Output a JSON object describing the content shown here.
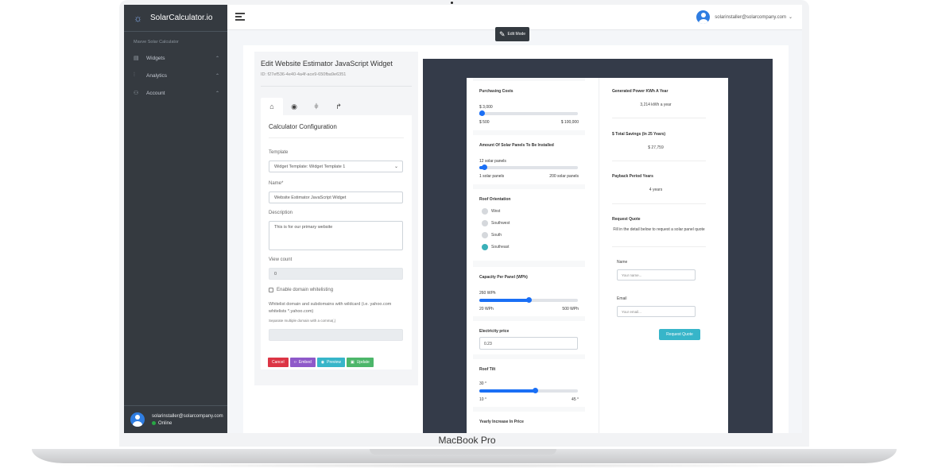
{
  "device": {
    "label": "MacBook Pro"
  },
  "sidebar": {
    "brand": "SolarCalculator.io",
    "section_title": "Mavve Solar Calculator",
    "items": [
      {
        "label": "Widgets",
        "icon": "table-icon"
      },
      {
        "label": "Analytics",
        "icon": "bar-chart-icon"
      },
      {
        "label": "Account",
        "icon": "users-icon"
      }
    ],
    "user_email": "solarinstaller@solarcompany.com",
    "status": "Online"
  },
  "topbar": {
    "user_email": "solarinstaller@solarcompany.com",
    "edit_mode_label": "Edit Mode"
  },
  "editor": {
    "title": "Edit Website Estimator JavaScript Widget",
    "id": "ID: f27ef536-4e40-4a4f-ace9-650fba9e6351",
    "config_title": "Calculator Configuration",
    "template_label": "Template",
    "template_value": "Widget Template: Widget Template 1",
    "name_label": "Name*",
    "name_value": "Website Estimator JavaScript Widget",
    "description_label": "Description",
    "description_value": "This is for our primary website",
    "view_count_label": "View count",
    "view_count_value": "0",
    "whitelist_checkbox": "Enable domain whitelisting",
    "whitelist_note": "Whitelist domain and subdomains with wildcard (i.e. yahoo.com whitelists *.yahoo.com)",
    "whitelist_small": "Separate multiple domain with a comma(,)",
    "buttons": {
      "cancel": "Cancel",
      "embed": "Embed",
      "preview": "Preview",
      "update": "Update"
    }
  },
  "widget": {
    "purchasing": {
      "title": "Purchasing Costs",
      "value": "$  3,000",
      "min": "$ 500",
      "max": "$ 100,000",
      "fraction": 0.025
    },
    "panels": {
      "title": "Amount Of Solar Panels To Be Installed",
      "value": "12  solar panels",
      "min": "1 solar panels",
      "max": "200 solar panels",
      "fraction": 0.055
    },
    "orientation": {
      "title": "Roof Orientation",
      "options": [
        "West",
        "Southwest",
        "South",
        "Southeast"
      ],
      "selected": "Southeast"
    },
    "capacity": {
      "title": "Capacity Per Panel (WPh)",
      "value": "260  WPh",
      "min": "20 WPh",
      "max": "500 WPh",
      "fraction": 0.5
    },
    "electricity": {
      "title": "Electricity price",
      "value": "0.23"
    },
    "tilt": {
      "title": "Roof Tilt",
      "value": "30  °",
      "min": "10 °",
      "max": "45 °",
      "fraction": 0.571
    },
    "yearly_increase": {
      "title": "Yearly Increase In Price"
    },
    "results": {
      "power_title": "Generated Power KWh A Year",
      "power_value": "3,214 kWh a year",
      "savings_title": "$ Total Savings (In 25 Years)",
      "savings_value": "$ 27,759",
      "payback_title": "Payback Period Years",
      "payback_value": "4 years"
    },
    "quote": {
      "title": "Request Quote",
      "desc": "Fill in the detail below to request a solar panel quote",
      "name_label": "Name",
      "name_placeholder": "Your name...",
      "email_label": "Email",
      "email_placeholder": "Your email...",
      "button": "Request Quote"
    }
  },
  "colors": {
    "sidebar_bg": "#353a40",
    "preview_bg": "#343b49",
    "slider": "#1a6ff5",
    "accent_teal": "#37b5c9",
    "cancel_red": "#dc3545",
    "embed_purple": "#8e59c9",
    "update_green": "#4cb66a",
    "online_green": "#28a745"
  }
}
